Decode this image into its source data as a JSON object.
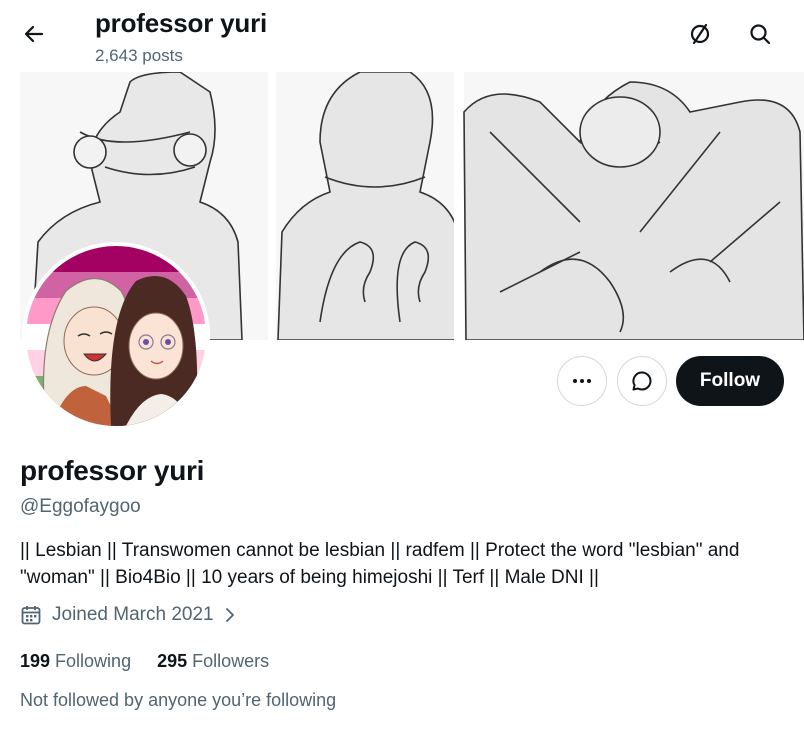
{
  "header": {
    "title": "professor yuri",
    "posts": "2,643 posts"
  },
  "icons": {
    "back": "arrow-left-icon",
    "timeline": "timeline-off-icon",
    "search": "search-icon",
    "more": "more-horizontal-icon",
    "message": "message-icon",
    "calendar": "calendar-icon",
    "chevron": "chevron-right-icon"
  },
  "actions": {
    "follow_label": "Follow"
  },
  "profile": {
    "display_name": "professor yuri",
    "handle": "@Eggofaygoo",
    "bio": "|| Lesbian || Transwomen cannot be lesbian || radfem || Protect the word \"lesbian\" and \"woman\" || Bio4Bio || 10 years of being himejoshi || Terf || Male DNI ||",
    "joined": "Joined March 2021"
  },
  "stats": {
    "following_count": "199",
    "following_label": "Following",
    "followers_count": "295",
    "followers_label": "Followers"
  },
  "followed_by": "Not followed by anyone you’re following",
  "colors": {
    "text_primary": "#0f1419",
    "text_secondary": "#536471",
    "follow_bg": "#0f1419",
    "avatar_ring": [
      "#d52d00",
      "#ef7627",
      "#ff9a56",
      "#ffffff",
      "#d162a4",
      "#b55690",
      "#a30262"
    ]
  }
}
